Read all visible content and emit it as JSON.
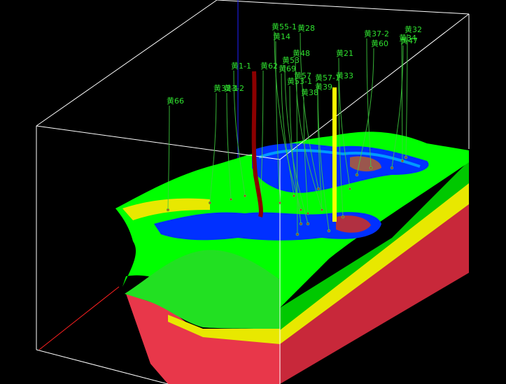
{
  "viewer": {
    "background": "#000000",
    "box_color": "#ffffff",
    "axis_colors": {
      "x": "#ff0000",
      "y": "#00ff00",
      "z": "#0000ff"
    }
  },
  "colors": {
    "basement": "#e8374a",
    "basement_side": "#c8283a",
    "yellow_layer": "#e8e800",
    "green_layer": "#00ff00",
    "green_dark": "#00c800",
    "reservoir_blue": "#0030ff",
    "reservoir_cyan": "#00c8ff",
    "reservoir_hot": "#d03020",
    "trajectory": "#40d040",
    "well_yellow": "#ffff00",
    "well_red": "#8b0000"
  },
  "wells": [
    {
      "name": "黄66"
    },
    {
      "name": "黄32-1"
    },
    {
      "name": "黄3-2"
    },
    {
      "name": "黄1-1"
    },
    {
      "name": "黄62"
    },
    {
      "name": "黄55-1"
    },
    {
      "name": "黄14"
    },
    {
      "name": "黄69"
    },
    {
      "name": "黄53"
    },
    {
      "name": "黄48"
    },
    {
      "name": "黄28"
    },
    {
      "name": "黄57"
    },
    {
      "name": "黄57-1"
    },
    {
      "name": "黄33"
    },
    {
      "name": "黄53-1"
    },
    {
      "name": "黄39"
    },
    {
      "name": "黄38"
    },
    {
      "name": "黄37-2"
    },
    {
      "name": "黄34"
    },
    {
      "name": "黄32"
    },
    {
      "name": "黄47"
    },
    {
      "name": "黄60"
    },
    {
      "name": "黄21"
    }
  ]
}
